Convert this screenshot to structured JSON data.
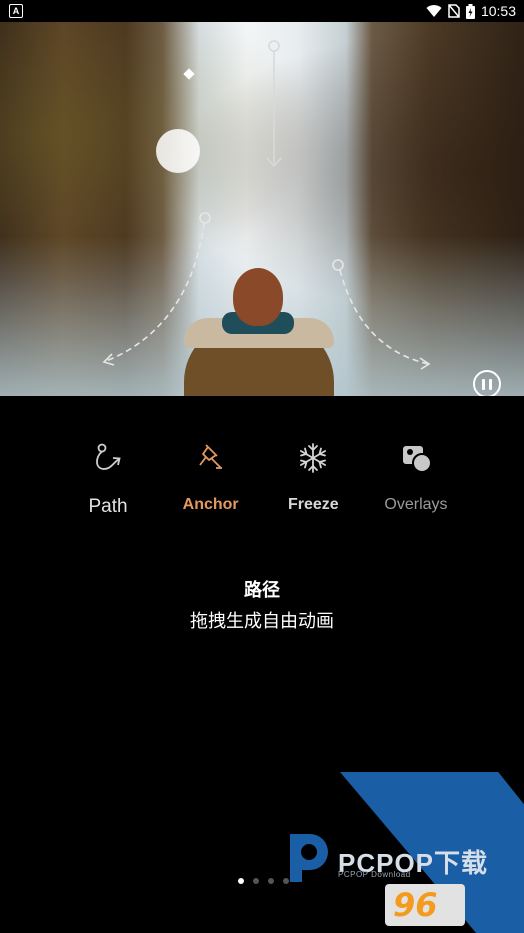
{
  "status_bar": {
    "app_icon_letter": "A",
    "time": "10:53"
  },
  "hero": {
    "description": ""
  },
  "tools": [
    {
      "label": "Path",
      "icon": "path-icon",
      "state": "default"
    },
    {
      "label": "Anchor",
      "icon": "anchor-pin-icon",
      "state": "selected"
    },
    {
      "label": "Freeze",
      "icon": "snowflake-icon",
      "state": "default"
    },
    {
      "label": "Overlays",
      "icon": "overlays-icon",
      "state": "default"
    }
  ],
  "description": {
    "title": "路径",
    "subtitle": "拖拽生成自由动画"
  },
  "pager": {
    "count": 4,
    "active_index": 0
  },
  "watermark": {
    "text": "PCPOP下载",
    "sub": "PCPOP Download",
    "badge": "96"
  },
  "colors": {
    "accent_selected": "#e39a5f",
    "background": "#000000",
    "watermark_blue": "#1a5fa6"
  }
}
